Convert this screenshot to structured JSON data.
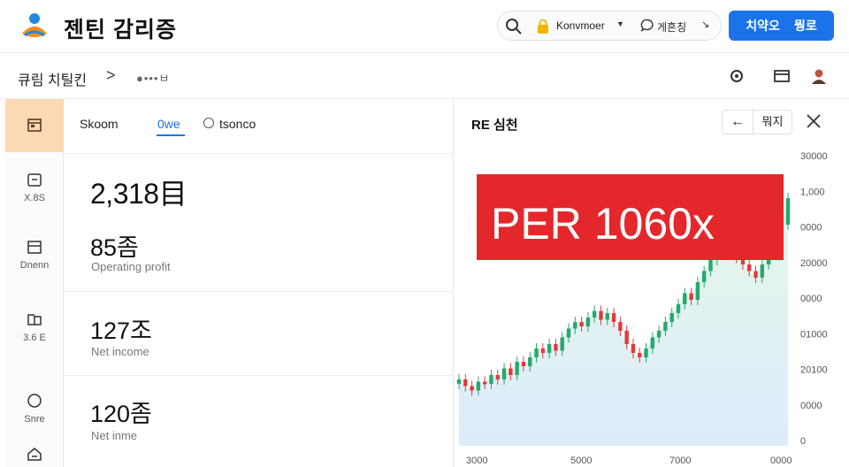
{
  "header": {
    "app_title": "젠틴 감리증",
    "account_name": "Konvmoer",
    "language": "게흔칭",
    "login_label": "치약오",
    "signup_label": "뭥로"
  },
  "breadcrumb": {
    "path": "큐림 치틸킨",
    "separator": ">",
    "sub": "●•••ㅂ"
  },
  "rail": {
    "items": [
      {
        "label": "",
        "icon": "calendar-icon"
      },
      {
        "label": "X.8S",
        "icon": "folder-icon"
      },
      {
        "label": "Dnenn",
        "icon": "box-icon"
      },
      {
        "label": "3.6 E",
        "icon": "bookmark-icon"
      },
      {
        "label": "Snre",
        "icon": "globe-icon"
      },
      {
        "label": "",
        "icon": "home-icon"
      }
    ]
  },
  "panel": {
    "tabs": [
      "Skoom",
      "0we",
      "tsonco"
    ],
    "metrics": [
      {
        "value": "2,318目",
        "label": ""
      },
      {
        "value": "85좀",
        "label": "Operating profit"
      },
      {
        "value": "127조",
        "label": "Net income"
      },
      {
        "value": "120좀",
        "label": "Net inme"
      }
    ]
  },
  "chart_panel": {
    "title": "RE 심천",
    "back_label": "←",
    "reset_label": "뭐지",
    "banner_text": "PER 1060x",
    "y_ticks": [
      "30000",
      "1,000",
      "0000",
      "20000",
      "0000",
      "01000",
      "20100",
      "0000",
      "0"
    ],
    "x_ticks": [
      "3000",
      "5000",
      "7000",
      "0000"
    ]
  },
  "chart_data": {
    "type": "line",
    "title": "",
    "y_tick_labels": [
      "30000",
      "1,000",
      "0000",
      "20000",
      "0000",
      "01000",
      "20100",
      "0000",
      "0"
    ],
    "x_tick_labels": [
      "3000",
      "5000",
      "7000",
      "0000"
    ],
    "series": [
      {
        "values": [
          14,
          11,
          9,
          13,
          12,
          16,
          14,
          19,
          16,
          22,
          20,
          24,
          28,
          26,
          30,
          27,
          33,
          37,
          40,
          38,
          42,
          45,
          41,
          44,
          40,
          36,
          30,
          26,
          24,
          28,
          33,
          36,
          40,
          44,
          48,
          53,
          50,
          58,
          63,
          68,
          72,
          76,
          72,
          69,
          66,
          63,
          60,
          66,
          72,
          78,
          84,
          96
        ]
      }
    ],
    "colors": {
      "up": "#26a96c",
      "down": "#e03b3b",
      "banner": "#e4272b",
      "area": "#d8f2e0"
    }
  }
}
